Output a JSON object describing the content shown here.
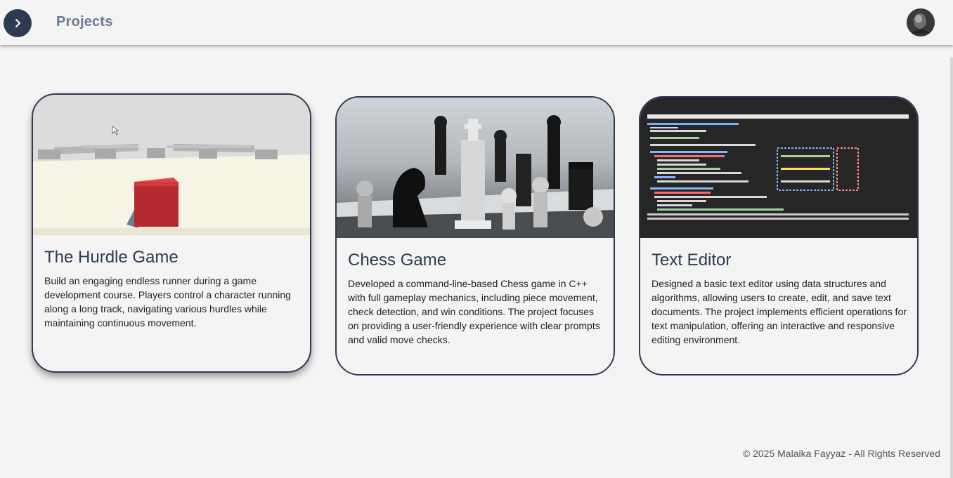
{
  "header": {
    "title": "Projects",
    "toggle_icon": "chevron-right-icon",
    "avatar_icon": "user-avatar"
  },
  "projects": [
    {
      "title": "The Hurdle Game",
      "description": "Build an engaging endless runner during a game development course. Players control a character running along a long track, navigating various hurdles while maintaining continuous movement.",
      "image": "hurdle-game-screenshot"
    },
    {
      "title": "Chess Game",
      "description": "Developed a command-line-based Chess game in C++ with full gameplay mechanics, including piece movement, check detection, and win conditions. The project focuses on providing a user-friendly experience with clear prompts and valid move checks.",
      "image": "chess-pieces-photo"
    },
    {
      "title": "Text Editor",
      "description": "Designed a basic text editor using data structures and algorithms, allowing users to create, edit, and save text documents. The project implements efficient operations for text manipulation, offering an interactive and responsive editing environment.",
      "image": "text-editor-screenshot"
    }
  ],
  "footer": {
    "copyright": "© 2025 Malaika Fayyaz - All Rights Reserved"
  },
  "colors": {
    "accent": "#2d3b52",
    "background": "#f4f4f4",
    "title_muted": "#6b7a90"
  }
}
